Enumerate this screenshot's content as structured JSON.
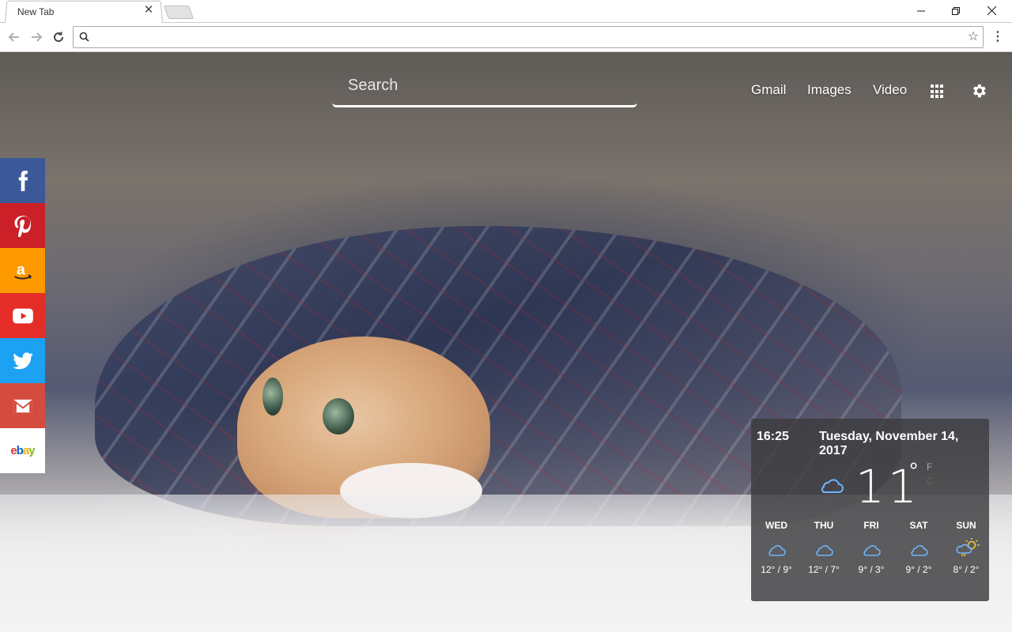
{
  "browser": {
    "tab_title": "New Tab",
    "tab_close": "✕",
    "omnibox_value": "",
    "menu_glyph": "⋮",
    "star_glyph": "☆"
  },
  "search": {
    "placeholder": "Search"
  },
  "top_links": {
    "gmail": "Gmail",
    "images": "Images",
    "video": "Video"
  },
  "social": [
    {
      "name": "facebook",
      "color": "#3b5998"
    },
    {
      "name": "pinterest",
      "color": "#cb2027"
    },
    {
      "name": "amazon",
      "color": "#ff9900"
    },
    {
      "name": "youtube",
      "color": "#e52d27"
    },
    {
      "name": "twitter",
      "color": "#1da1f2"
    },
    {
      "name": "gmail",
      "color": "#d54b3d"
    },
    {
      "name": "ebay",
      "color": "#ffffff"
    }
  ],
  "weather": {
    "time": "16:25",
    "date": "Tuesday, November 14, 2017",
    "current_temp": "11",
    "deg_symbol": "°",
    "unit_f": "F",
    "unit_c": "C",
    "current_icon": "cloud-icon",
    "forecast": [
      {
        "day": "WED",
        "range": "12° / 9°",
        "icon": "cloud-icon"
      },
      {
        "day": "THU",
        "range": "12° / 7°",
        "icon": "cloud-icon"
      },
      {
        "day": "FRI",
        "range": "9° / 3°",
        "icon": "cloud-icon"
      },
      {
        "day": "SAT",
        "range": "9° / 2°",
        "icon": "cloud-icon"
      },
      {
        "day": "SUN",
        "range": "8° / 2°",
        "icon": "sun-cloud-rain-icon"
      }
    ]
  }
}
